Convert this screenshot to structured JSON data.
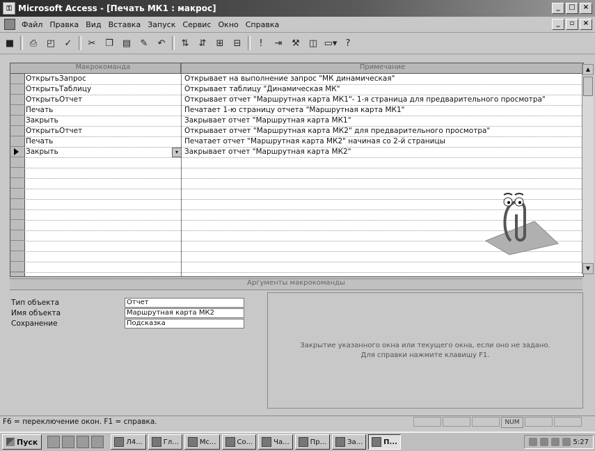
{
  "window": {
    "title": "Microsoft Access - [Печать МК1 : макрос]"
  },
  "menu": [
    "Файл",
    "Правка",
    "Вид",
    "Вставка",
    "Запуск",
    "Сервис",
    "Окно",
    "Справка"
  ],
  "grid": {
    "col1_header": "Макрокоманда",
    "col2_header": "Примечание",
    "rows": [
      {
        "action": "ОткрытьЗапрос",
        "note": "Открывает на выполнение запрос \"МК динамическая\""
      },
      {
        "action": "ОткрытьТаблицу",
        "note": "Открывает таблицу \"Динамическая МК\""
      },
      {
        "action": "ОткрытьОтчет",
        "note": "Открывает отчет \"Маршрутная карта МК1\"- 1-я страница для предварительного просмотра\""
      },
      {
        "action": "Печать",
        "note": "Печатает 1-ю  страницу отчета \"Маршрутная карта МК1\""
      },
      {
        "action": "Закрыть",
        "note": "Закрывает отчет \"Маршрутная карта МК1\""
      },
      {
        "action": "ОткрытьОтчет",
        "note": "Открывает отчет \"Маршрутная карта МК2\" для предварительного просмотра\""
      },
      {
        "action": "Печать",
        "note": "Печатает отчет \"Маршрутная карта МК2\" начиная со 2-й страницы"
      },
      {
        "action": "Закрыть",
        "note": "Закрывает отчет \"Маршрутная карта МК2\""
      }
    ]
  },
  "args": {
    "header": "Аргументы макрокоманды",
    "items": [
      {
        "label": "Тип объекта",
        "value": "Отчет"
      },
      {
        "label": "Имя объекта",
        "value": "Маршрутная карта МК2"
      },
      {
        "label": "Сохранение",
        "value": "Подсказка"
      }
    ],
    "hint": "Закрытие указанного окна или текущего окна, если оно не задано.  Для справки нажмите клавишу F1."
  },
  "status": {
    "text": "F6 = переключение окон.  F1 = справка.",
    "num": "NUM"
  },
  "taskbar": {
    "start": "Пуск",
    "tasks": [
      "Л4...",
      "Гл...",
      "Мс...",
      "Со...",
      "Ча...",
      "Пр...",
      "За...",
      "П..."
    ],
    "time": "5:27"
  },
  "icons": {
    "app": "access-key-icon",
    "toolbar": [
      "save-icon",
      "print-icon",
      "preview-icon",
      "spell-icon",
      "cut-icon",
      "copy-icon",
      "paste-icon",
      "format-painter-icon",
      "undo-icon",
      "insert-rows-icon",
      "delete-rows-icon",
      "macro-names-icon",
      "conditions-icon",
      "run-icon",
      "step-icon",
      "build-icon",
      "database-window-icon",
      "new-object-icon",
      "help-icon"
    ]
  }
}
